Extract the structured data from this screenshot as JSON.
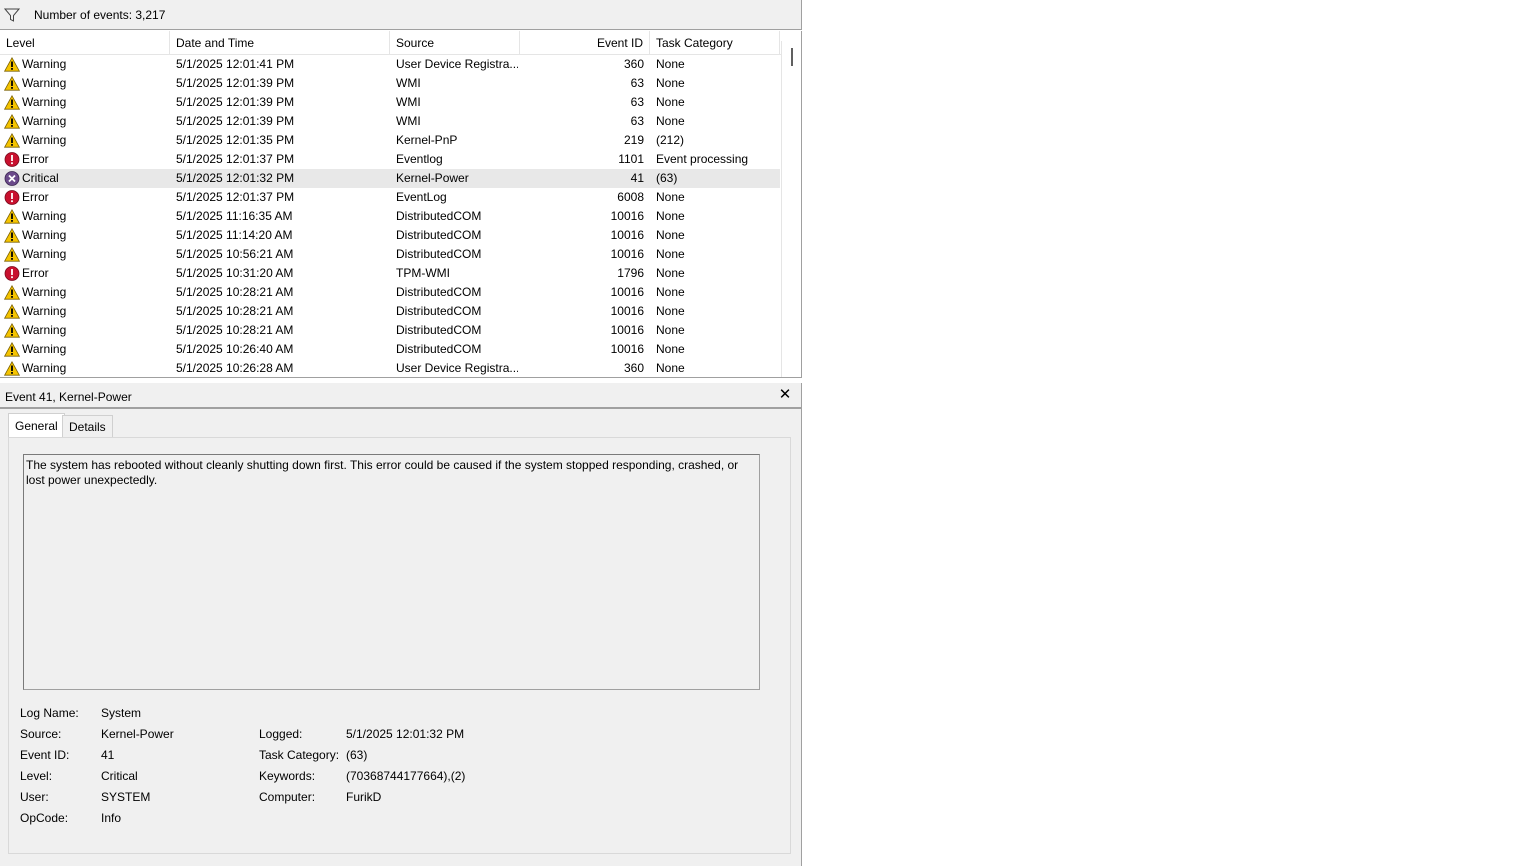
{
  "toolbar": {
    "filter_icon": "filter-funnel-icon",
    "event_count": "Number of events: 3,217"
  },
  "list": {
    "columns": {
      "level": "Level",
      "datetime": "Date and Time",
      "source": "Source",
      "event_id": "Event ID",
      "task_category": "Task Category"
    },
    "rows": [
      {
        "level": "Warning",
        "icon": "warning-icon",
        "datetime": "5/1/2025 12:01:41 PM",
        "source": "User Device Registra...",
        "event_id": "360",
        "task_category": "None"
      },
      {
        "level": "Warning",
        "icon": "warning-icon",
        "datetime": "5/1/2025 12:01:39 PM",
        "source": "WMI",
        "event_id": "63",
        "task_category": "None"
      },
      {
        "level": "Warning",
        "icon": "warning-icon",
        "datetime": "5/1/2025 12:01:39 PM",
        "source": "WMI",
        "event_id": "63",
        "task_category": "None"
      },
      {
        "level": "Warning",
        "icon": "warning-icon",
        "datetime": "5/1/2025 12:01:39 PM",
        "source": "WMI",
        "event_id": "63",
        "task_category": "None"
      },
      {
        "level": "Warning",
        "icon": "warning-icon",
        "datetime": "5/1/2025 12:01:35 PM",
        "source": "Kernel-PnP",
        "event_id": "219",
        "task_category": "(212)"
      },
      {
        "level": "Error",
        "icon": "error-icon",
        "datetime": "5/1/2025 12:01:37 PM",
        "source": "Eventlog",
        "event_id": "1101",
        "task_category": "Event processing"
      },
      {
        "level": "Critical",
        "icon": "critical-icon",
        "datetime": "5/1/2025 12:01:32 PM",
        "source": "Kernel-Power",
        "event_id": "41",
        "task_category": "(63)",
        "selected": true
      },
      {
        "level": "Error",
        "icon": "error-icon",
        "datetime": "5/1/2025 12:01:37 PM",
        "source": "EventLog",
        "event_id": "6008",
        "task_category": "None"
      },
      {
        "level": "Warning",
        "icon": "warning-icon",
        "datetime": "5/1/2025 11:16:35 AM",
        "source": "DistributedCOM",
        "event_id": "10016",
        "task_category": "None"
      },
      {
        "level": "Warning",
        "icon": "warning-icon",
        "datetime": "5/1/2025 11:14:20 AM",
        "source": "DistributedCOM",
        "event_id": "10016",
        "task_category": "None"
      },
      {
        "level": "Warning",
        "icon": "warning-icon",
        "datetime": "5/1/2025 10:56:21 AM",
        "source": "DistributedCOM",
        "event_id": "10016",
        "task_category": "None"
      },
      {
        "level": "Error",
        "icon": "error-icon",
        "datetime": "5/1/2025 10:31:20 AM",
        "source": "TPM-WMI",
        "event_id": "1796",
        "task_category": "None"
      },
      {
        "level": "Warning",
        "icon": "warning-icon",
        "datetime": "5/1/2025 10:28:21 AM",
        "source": "DistributedCOM",
        "event_id": "10016",
        "task_category": "None"
      },
      {
        "level": "Warning",
        "icon": "warning-icon",
        "datetime": "5/1/2025 10:28:21 AM",
        "source": "DistributedCOM",
        "event_id": "10016",
        "task_category": "None"
      },
      {
        "level": "Warning",
        "icon": "warning-icon",
        "datetime": "5/1/2025 10:28:21 AM",
        "source": "DistributedCOM",
        "event_id": "10016",
        "task_category": "None"
      },
      {
        "level": "Warning",
        "icon": "warning-icon",
        "datetime": "5/1/2025 10:26:40 AM",
        "source": "DistributedCOM",
        "event_id": "10016",
        "task_category": "None"
      },
      {
        "level": "Warning",
        "icon": "warning-icon",
        "datetime": "5/1/2025 10:26:28 AM",
        "source": "User Device Registra...",
        "event_id": "360",
        "task_category": "None"
      }
    ]
  },
  "detail": {
    "title": "Event 41, Kernel-Power",
    "close_label": "✕",
    "tabs": {
      "general": "General",
      "details": "Details"
    },
    "description": "The system has rebooted without cleanly shutting down first. This error could be caused if the system stopped responding, crashed, or lost power unexpectedly.",
    "properties": {
      "log_name_label": "Log Name:",
      "log_name": "System",
      "source_label": "Source:",
      "source": "Kernel-Power",
      "logged_label": "Logged:",
      "logged": "5/1/2025 12:01:32 PM",
      "event_id_label": "Event ID:",
      "event_id": "41",
      "task_category_label": "Task Category:",
      "task_category": "(63)",
      "level_label": "Level:",
      "level": "Critical",
      "keywords_label": "Keywords:",
      "keywords": "(70368744177664),(2)",
      "user_label": "User:",
      "user": "SYSTEM",
      "computer_label": "Computer:",
      "computer": "FurikD",
      "opcode_label": "OpCode:",
      "opcode": "Info"
    }
  },
  "colors": {
    "warning": "#f5c400",
    "error": "#c8102e",
    "critical": "#6b4a8a",
    "selected_row": "#e8e8e8",
    "pane_bg": "#f0f0f0"
  }
}
